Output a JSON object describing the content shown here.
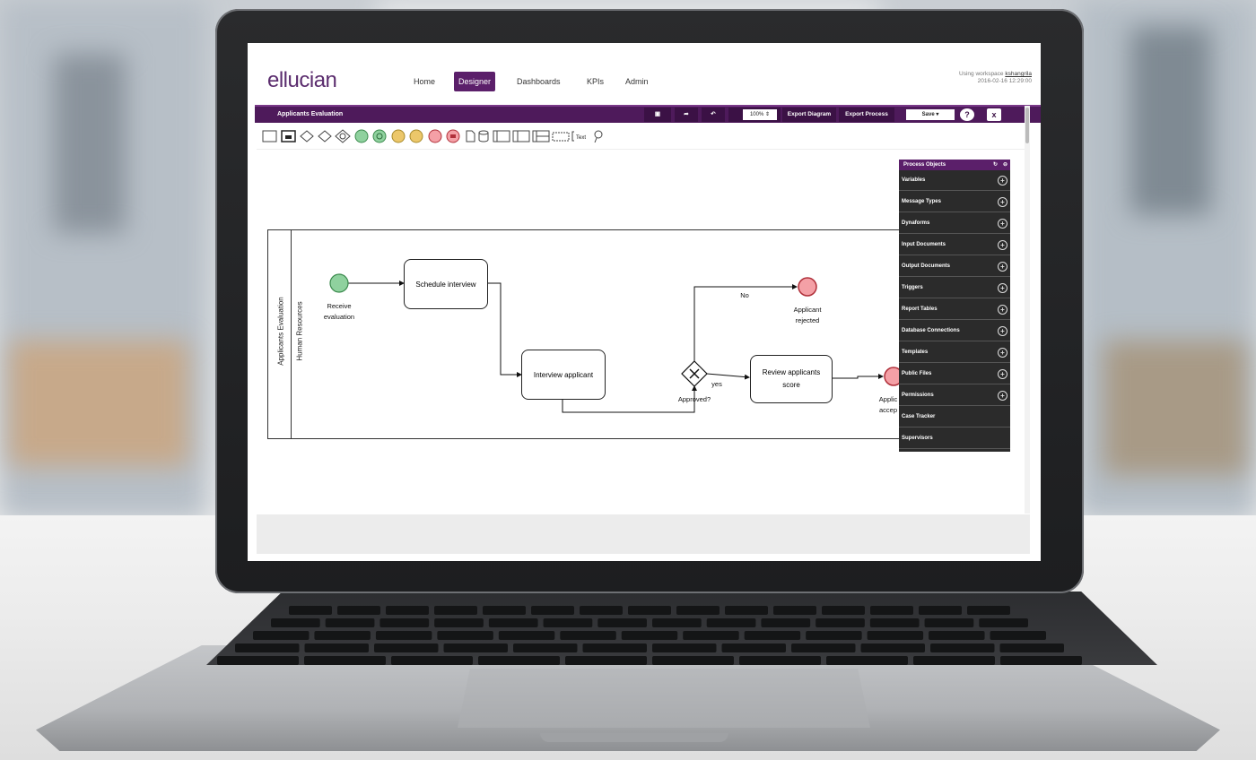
{
  "header": {
    "logo": "ellucian",
    "nav": [
      "Home",
      "Designer",
      "Dashboards",
      "KPIs",
      "Admin"
    ],
    "active_nav": "Designer",
    "workspace_prefix": "Using workspace",
    "workspace_name": "kshangrila",
    "workspace_date": "2016-02-16 12:29:00"
  },
  "toolbar": {
    "title": "Applicants Evaluation",
    "zoom": "100%",
    "export_diagram": "Export Diagram",
    "export_process": "Export Process",
    "save": "Save",
    "help": "?",
    "close": "x"
  },
  "shape_palette": {
    "text_tool": "Text"
  },
  "diagram": {
    "pool_label": "Applicants Evaluation",
    "lane_label": "Human Resources",
    "start_label": "Receive evaluation",
    "task1": "Schedule interview",
    "task2": "Interview applicant",
    "task3": "Review applicants score",
    "gateway_label": "Approved?",
    "flow_no": "No",
    "flow_yes": "yes",
    "end_rejected": "Applicant rejected",
    "end_accepted": "Applic accep"
  },
  "process_objects": {
    "title": "Process Objects",
    "items": [
      {
        "label": "Variables",
        "plus": true
      },
      {
        "label": "Message Types",
        "plus": true
      },
      {
        "label": "Dynaforms",
        "plus": true
      },
      {
        "label": "Input Documents",
        "plus": true
      },
      {
        "label": "Output Documents",
        "plus": true
      },
      {
        "label": "Triggers",
        "plus": true
      },
      {
        "label": "Report Tables",
        "plus": true
      },
      {
        "label": "Database Connections",
        "plus": true
      },
      {
        "label": "Templates",
        "plus": true
      },
      {
        "label": "Public Files",
        "plus": true
      },
      {
        "label": "Permissions",
        "plus": true
      },
      {
        "label": "Case Tracker",
        "plus": false
      },
      {
        "label": "Supervisors",
        "plus": false
      }
    ]
  },
  "colors": {
    "brand": "#5b1f6a",
    "toolbar": "#4e1a5b",
    "start_event": "#8fd19e",
    "end_event": "#f4a0a6",
    "panel": "#2b2b2b"
  }
}
